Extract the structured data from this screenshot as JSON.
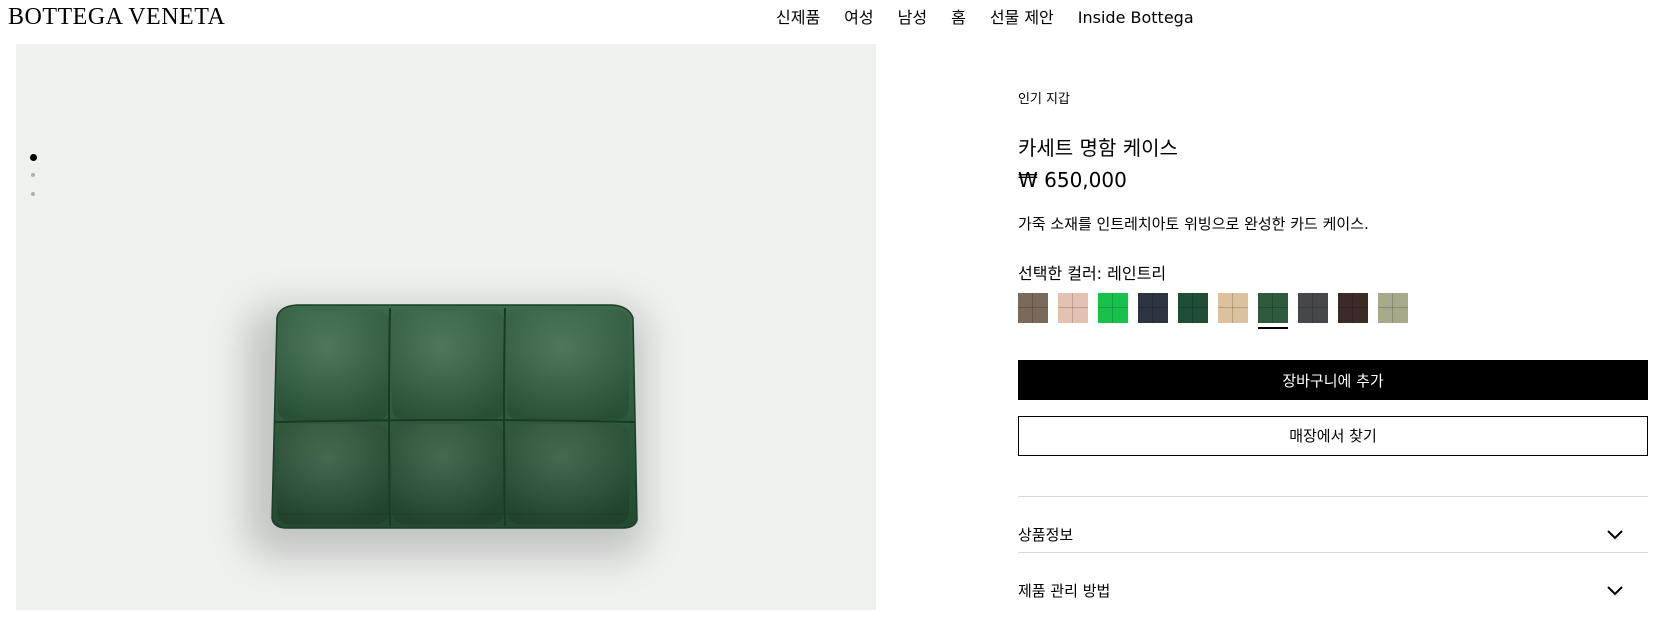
{
  "header": {
    "logo": "BOTTEGA VENETA",
    "nav": [
      "신제품",
      "여성",
      "남성",
      "홈",
      "선물 제안",
      "Inside Bottega"
    ]
  },
  "gallery": {
    "image_count": 3,
    "active_index": 0,
    "product_color": "#2e5b3c"
  },
  "product": {
    "category": "인기 지갑",
    "title": "카세트 명함 케이스",
    "price": "₩ 650,000",
    "description": "가죽 소재를 인트레치아토 위빙으로 완성한 카드 케이스.",
    "color_label": "선택한 컬러: 레인트리",
    "selected_swatch_index": 6,
    "swatches": [
      {
        "color": "#7b6a5a"
      },
      {
        "color": "#e4c2b2"
      },
      {
        "color": "#16c24a"
      },
      {
        "color": "#2c3442"
      },
      {
        "color": "#1f4d36"
      },
      {
        "color": "#dcc29c"
      },
      {
        "color": "#2e5b3c"
      },
      {
        "color": "#45474b"
      },
      {
        "color": "#3b2a28"
      },
      {
        "color": "#a8a98a"
      }
    ]
  },
  "actions": {
    "add_to_cart": "장바구니에 추가",
    "find_in_store": "매장에서 찾기"
  },
  "accordion": [
    {
      "label": "상품정보"
    },
    {
      "label": "제품 관리 방법"
    }
  ]
}
